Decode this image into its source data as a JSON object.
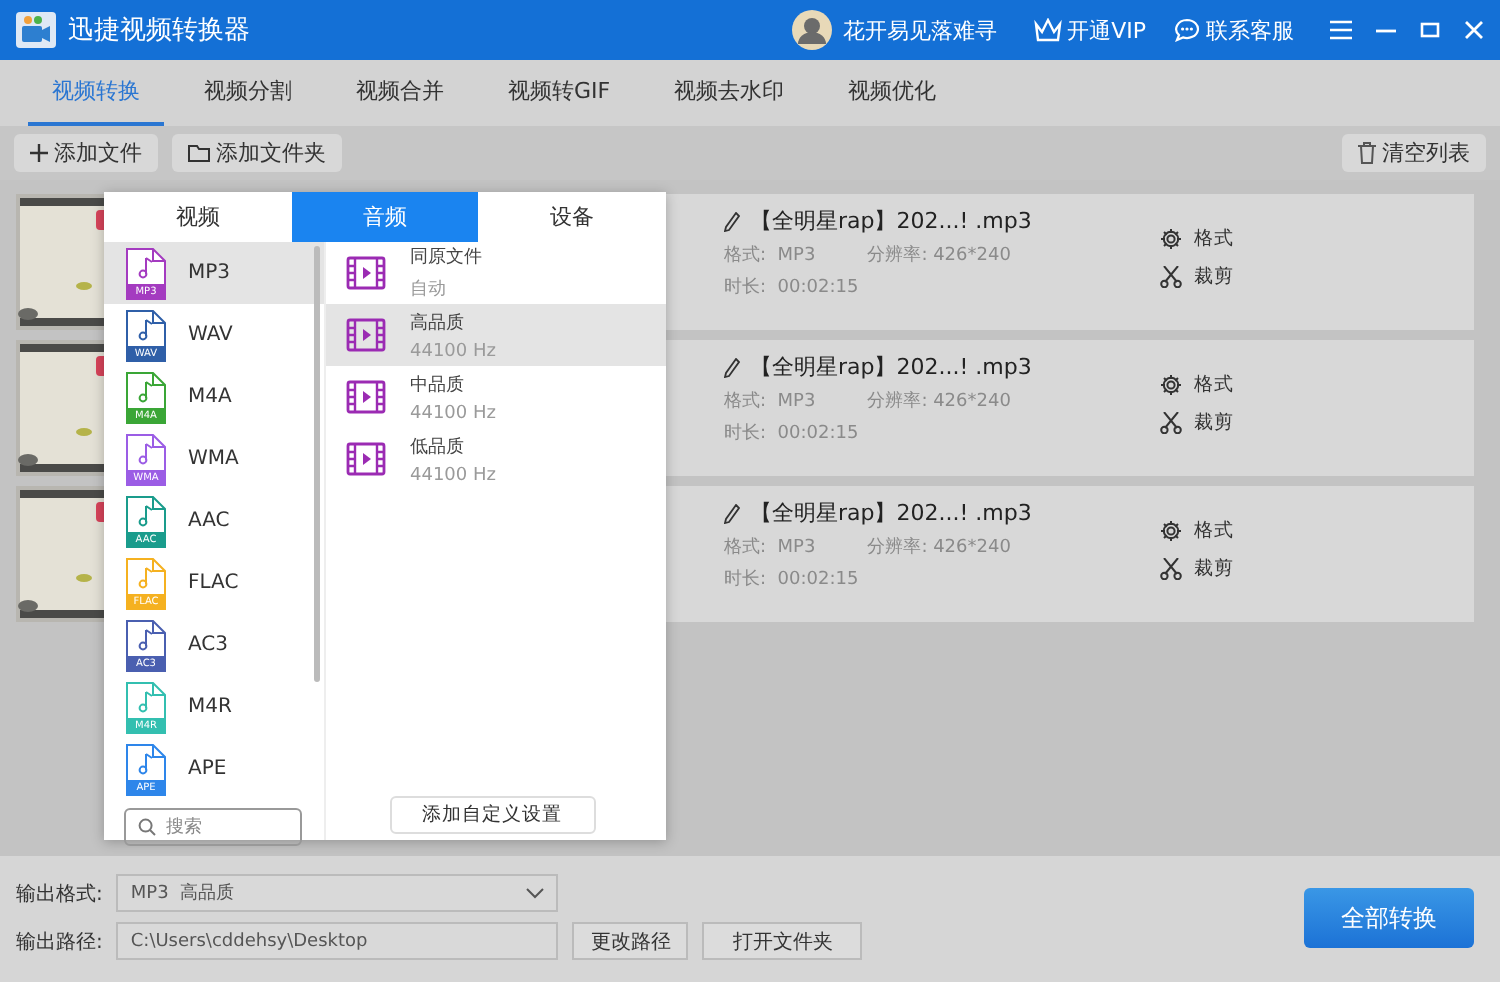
{
  "window": {
    "title": "迅捷视频转换器",
    "user": "花开易见落难寻",
    "links": [
      {
        "kind": "vip",
        "label": "开通VIP"
      },
      {
        "kind": "service",
        "label": "联系客服"
      }
    ]
  },
  "tabs": [
    {
      "label": "视频转换",
      "selected": true
    },
    {
      "label": "视频分割",
      "selected": false
    },
    {
      "label": "视频合并",
      "selected": false
    },
    {
      "label": "视频转GIF",
      "selected": false
    },
    {
      "label": "视频去水印",
      "selected": false
    },
    {
      "label": "视频优化",
      "selected": false
    }
  ],
  "toolbar": {
    "buttons": [
      {
        "kind": "add-file",
        "label": "添加文件"
      },
      {
        "kind": "add-folder",
        "label": "添加文件夹"
      }
    ],
    "clear": "清空列表"
  },
  "files": [
    {
      "name": "【全明星rap】202...! .mp3",
      "format": "格式:  MP3",
      "resolution": "分辨率: 426*240",
      "duration": "时长:  00:02:15",
      "actions": [
        {
          "kind": "format",
          "label": "格式"
        },
        {
          "kind": "trim",
          "label": "裁剪"
        }
      ]
    },
    {
      "name": "【全明星rap】202...! .mp3",
      "format": "格式:  MP3",
      "resolution": "分辨率: 426*240",
      "duration": "时长:  00:02:15",
      "actions": [
        {
          "kind": "format",
          "label": "格式"
        },
        {
          "kind": "trim",
          "label": "裁剪"
        }
      ]
    },
    {
      "name": "【全明星rap】202...! .mp3",
      "format": "格式:  MP3",
      "resolution": "分辨率: 426*240",
      "duration": "时长:  00:02:15",
      "actions": [
        {
          "kind": "format",
          "label": "格式"
        },
        {
          "kind": "trim",
          "label": "裁剪"
        }
      ]
    }
  ],
  "format_popup": {
    "tabs": [
      {
        "label": "视频",
        "selected": false
      },
      {
        "label": "音频",
        "selected": true
      },
      {
        "label": "设备",
        "selected": false
      }
    ],
    "formats": [
      {
        "name": "MP3",
        "badge": "MP3",
        "color": "#a43bc0",
        "selected": true
      },
      {
        "name": "WAV",
        "badge": "WAV",
        "color": "#2f5fa8",
        "selected": false
      },
      {
        "name": "M4A",
        "badge": "M4A",
        "color": "#3aa636",
        "selected": false
      },
      {
        "name": "WMA",
        "badge": "WMA",
        "color": "#9b5de5",
        "selected": false
      },
      {
        "name": "AAC",
        "badge": "AAC",
        "color": "#1a9c8c",
        "selected": false
      },
      {
        "name": "FLAC",
        "badge": "FLAC",
        "color": "#f5b120",
        "selected": false
      },
      {
        "name": "AC3",
        "badge": "AC3",
        "color": "#4a5fb0",
        "selected": false
      },
      {
        "name": "M4R",
        "badge": "M4R",
        "color": "#33bfb0",
        "selected": false
      },
      {
        "name": "APE",
        "badge": "APE",
        "color": "#2e86ea",
        "selected": false
      }
    ],
    "presets": [
      {
        "name": "同原文件",
        "detail": "自动",
        "selected": false
      },
      {
        "name": "高品质",
        "detail": "44100 Hz",
        "selected": true
      },
      {
        "name": "中品质",
        "detail": "44100 Hz",
        "selected": false
      },
      {
        "name": "低品质",
        "detail": "44100 Hz",
        "selected": false
      }
    ],
    "search": {
      "placeholder": "搜索"
    },
    "custom_button": "添加自定义设置"
  },
  "output": {
    "format_label": "输出格式:",
    "format_value": "MP3  高品质",
    "path_label": "输出路径:",
    "path_value": "C:\\Users\\cddehsy\\Desktop",
    "buttons": [
      "更改路径",
      "打开文件夹"
    ],
    "convert": "全部转换"
  }
}
